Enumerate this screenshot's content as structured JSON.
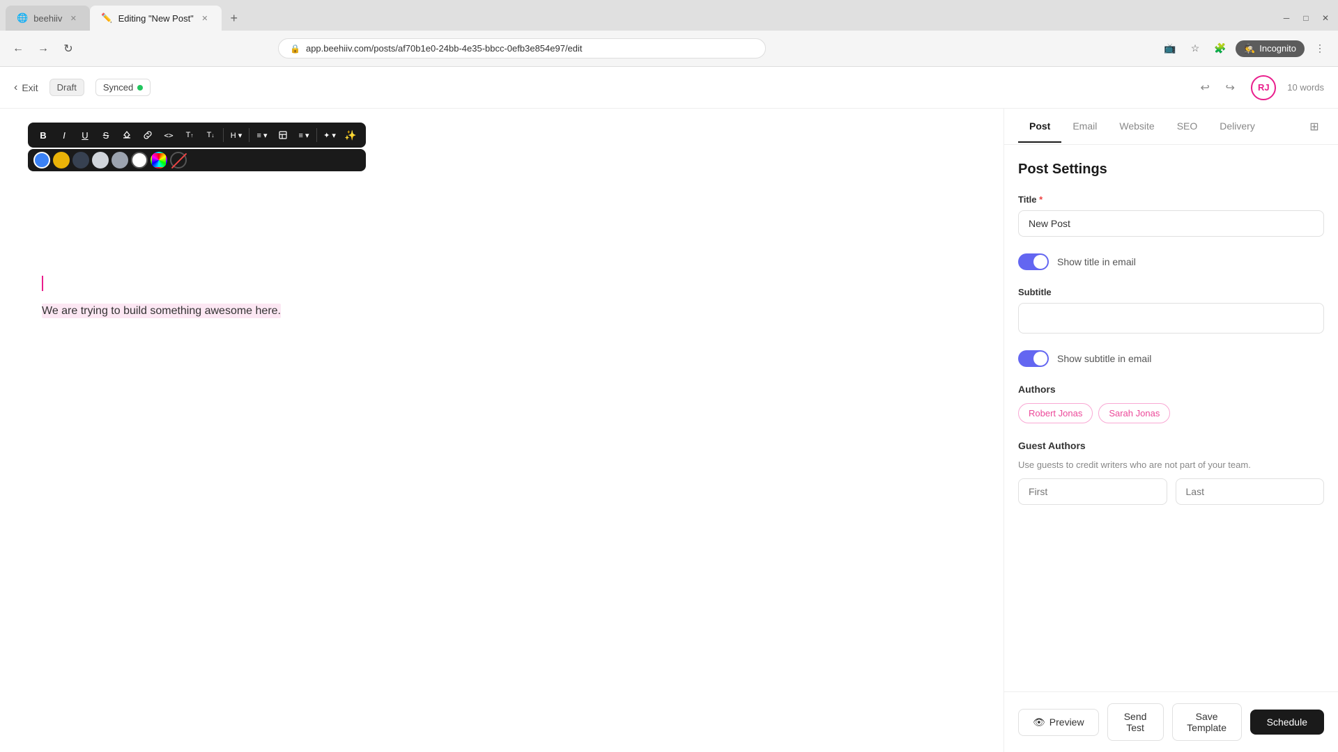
{
  "browser": {
    "tabs": [
      {
        "id": "beehiiv",
        "label": "beehiiv",
        "active": false,
        "favicon": "🌐"
      },
      {
        "id": "editing",
        "label": "Editing \"New Post\"",
        "active": true,
        "favicon": "✏️"
      }
    ],
    "address": "app.beehiiv.com/posts/af70b1e0-24bb-4e35-bbcc-0efb3e854e97/edit",
    "new_tab_icon": "+",
    "incognito_label": "Incognito",
    "window_controls": [
      "─",
      "□",
      "✕"
    ]
  },
  "toolbar": {
    "exit_label": "Exit",
    "draft_label": "Draft",
    "synced_label": "Synced",
    "word_count": "10 words",
    "avatar_initials": "RJ",
    "undo_icon": "↩",
    "redo_icon": "↪",
    "formatting_buttons": [
      {
        "label": "B",
        "title": "Bold"
      },
      {
        "label": "I",
        "title": "Italic"
      },
      {
        "label": "U",
        "title": "Underline"
      },
      {
        "label": "S",
        "title": "Strikethrough"
      },
      {
        "label": "🖊",
        "title": "Highlight"
      },
      {
        "label": "🔗",
        "title": "Link"
      },
      {
        "label": "<>",
        "title": "Code"
      },
      {
        "label": "T↑",
        "title": "Superscript"
      },
      {
        "label": "T↓",
        "title": "Subscript"
      },
      {
        "label": "H▾",
        "title": "Heading"
      },
      {
        "label": "≡▾",
        "title": "List"
      },
      {
        "label": "⊞",
        "title": "Block"
      },
      {
        "label": "≡▾",
        "title": "Align"
      },
      {
        "label": "✦▾",
        "title": "Insert"
      },
      {
        "label": "✨",
        "title": "AI"
      }
    ],
    "colors": [
      {
        "name": "blue",
        "value": "#3b82f6"
      },
      {
        "name": "yellow",
        "value": "#eab308"
      },
      {
        "name": "dark-gray",
        "value": "#374151"
      },
      {
        "name": "light-gray2",
        "value": "#d1d5db"
      },
      {
        "name": "medium-gray",
        "value": "#9ca3af"
      },
      {
        "name": "white",
        "value": "#ffffff"
      },
      {
        "name": "rainbow",
        "value": "rainbow"
      },
      {
        "name": "none",
        "value": "none"
      }
    ]
  },
  "editor": {
    "cursor_indicator": "|",
    "selected_text": "We are trying to build something awesome here."
  },
  "panel": {
    "tabs": [
      {
        "id": "post",
        "label": "Post",
        "active": true
      },
      {
        "id": "email",
        "label": "Email",
        "active": false
      },
      {
        "id": "website",
        "label": "Website",
        "active": false
      },
      {
        "id": "seo",
        "label": "SEO",
        "active": false
      },
      {
        "id": "delivery",
        "label": "Delivery",
        "active": false
      }
    ],
    "title": "Post Settings",
    "title_field": {
      "label": "Title",
      "required": true,
      "value": "New Post"
    },
    "show_title_toggle": {
      "label": "Show title in email",
      "enabled": true
    },
    "subtitle_field": {
      "label": "Subtitle",
      "value": "",
      "placeholder": ""
    },
    "show_subtitle_toggle": {
      "label": "Show subtitle in email",
      "enabled": true
    },
    "authors_section": {
      "label": "Authors",
      "authors": [
        {
          "name": "Robert Jonas"
        },
        {
          "name": "Sarah Jonas"
        }
      ]
    },
    "guest_authors_section": {
      "label": "Guest Authors",
      "description": "Use guests to credit writers who are not part of your team."
    },
    "footer_buttons": {
      "preview": "Preview",
      "send_test": "Send Test",
      "save_template": "Save Template",
      "schedule": "Schedule"
    }
  }
}
